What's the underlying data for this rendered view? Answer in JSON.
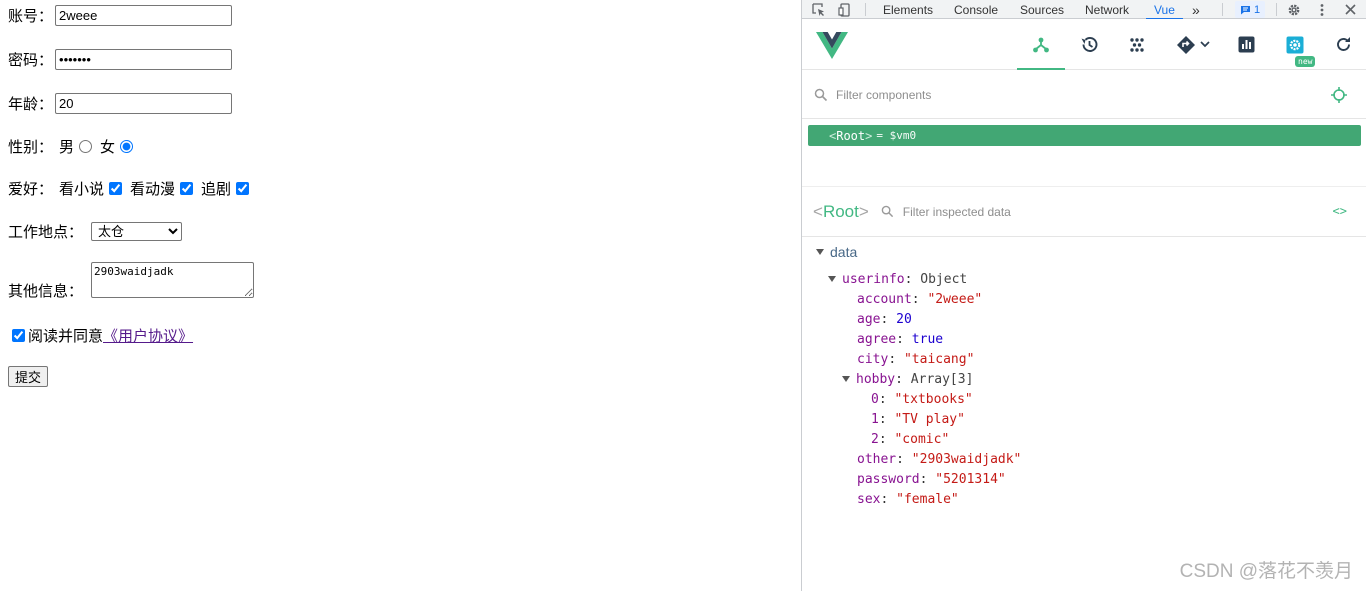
{
  "form": {
    "account_label": "账号：",
    "account_value": "2weee",
    "password_label": "密码：",
    "password_value": "5201314",
    "age_label": "年龄：",
    "age_value": "20",
    "sex_label": "性别：",
    "sex_male": "男",
    "sex_female": "女",
    "hobby_label": "爱好：",
    "hobby_1": "看小说",
    "hobby_2": "看动漫",
    "hobby_3": "追剧",
    "city_label": "工作地点：",
    "city_value": "太仓",
    "other_label": "其他信息：",
    "other_value": "2903waidjadk",
    "agree_text": "阅读并同意",
    "agree_link": "《用户协议》",
    "submit_label": "提交"
  },
  "devtools": {
    "tabs": [
      "Elements",
      "Console",
      "Sources",
      "Network",
      "Vue"
    ],
    "active_tab": "Vue",
    "more_tabs": "»",
    "message_count": "1"
  },
  "vue": {
    "filter_components_placeholder": "Filter components",
    "new_badge": "new",
    "root": {
      "open": "<",
      "name": "Root",
      "close": ">",
      "assign": "= $vm0"
    },
    "inspector": {
      "open": "<",
      "name": "Root",
      "close": ">",
      "filter_placeholder": "Filter inspected data",
      "code_icon": "<>"
    },
    "state": {
      "section": "data",
      "rows": [
        {
          "key": "userinfo",
          "value": "Object",
          "kind": "obj"
        },
        {
          "key": "account",
          "value": "\"2weee\"",
          "kind": "str"
        },
        {
          "key": "age",
          "value": "20",
          "kind": "num"
        },
        {
          "key": "agree",
          "value": "true",
          "kind": "num"
        },
        {
          "key": "city",
          "value": "\"taicang\"",
          "kind": "str"
        },
        {
          "key": "hobby",
          "value": "Array[3]",
          "kind": "obj"
        },
        {
          "key": "0",
          "value": "\"txtbooks\"",
          "kind": "str"
        },
        {
          "key": "1",
          "value": "\"TV play\"",
          "kind": "str"
        },
        {
          "key": "2",
          "value": "\"comic\"",
          "kind": "str"
        },
        {
          "key": "other",
          "value": "\"2903waidjadk\"",
          "kind": "str"
        },
        {
          "key": "password",
          "value": "\"5201314\"",
          "kind": "str"
        },
        {
          "key": "sex",
          "value": "\"female\"",
          "kind": "str"
        }
      ]
    }
  },
  "watermark": "CSDN @落花不羡月",
  "colors": {
    "vue_green": "#42b883",
    "root_row": "#42a774",
    "devtools_blue": "#1a73e8"
  }
}
